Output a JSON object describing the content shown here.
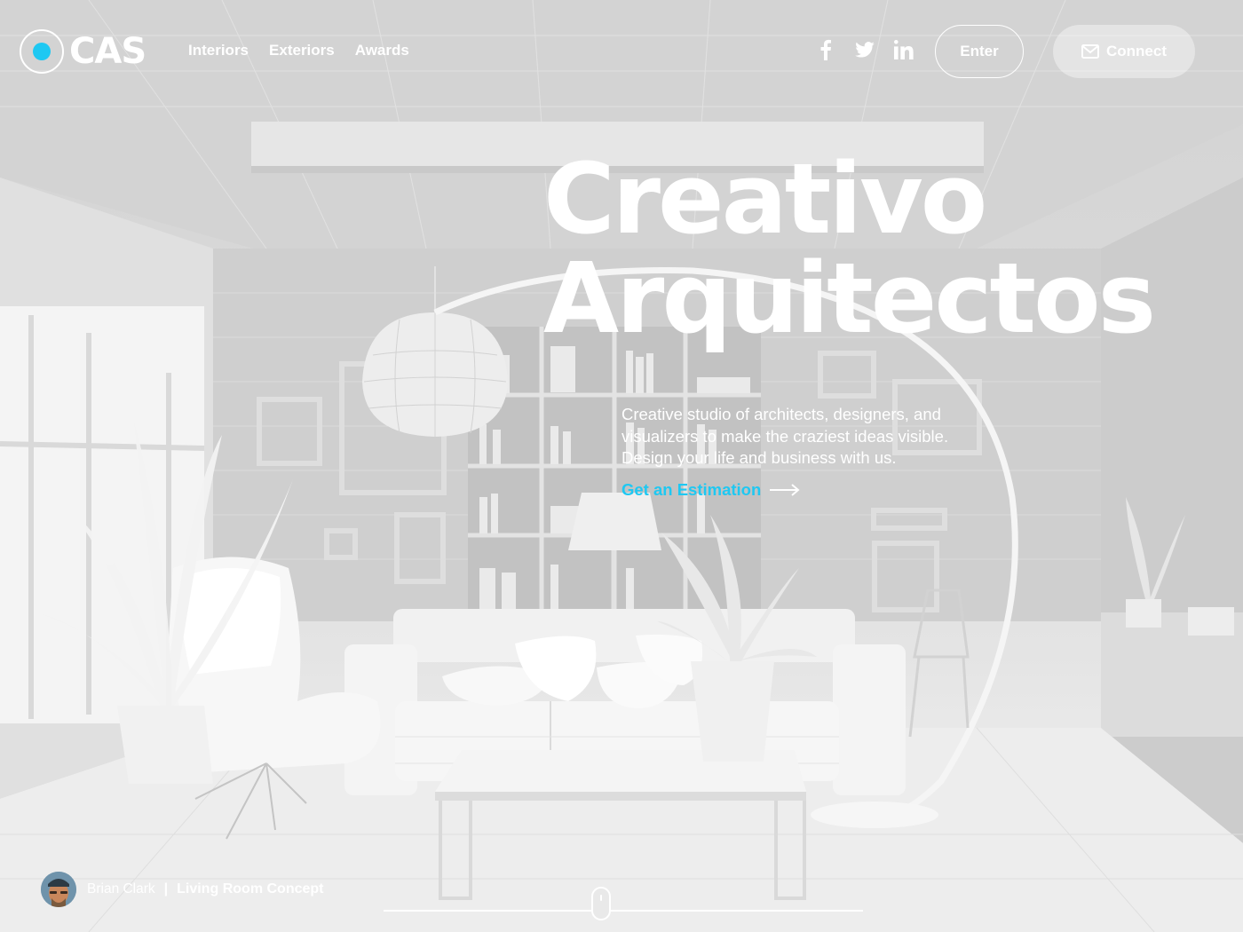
{
  "brand": {
    "logo_text": "CAS",
    "accent_color": "#1ec8f2"
  },
  "nav": {
    "items": [
      {
        "label": "Interiors"
      },
      {
        "label": "Exteriors"
      },
      {
        "label": "Awards"
      }
    ]
  },
  "social": {
    "icons": [
      "facebook-icon",
      "twitter-icon",
      "linkedin-icon"
    ]
  },
  "header": {
    "enter_label": "Enter",
    "connect_label": "Connect",
    "connect_icon": "mail-icon"
  },
  "hero": {
    "title_line1": "Creativo",
    "title_line2": "Arquitectos",
    "description_lines": [
      "Creative studio of architects, designers, and",
      "visualizers to make the craziest ideas visible.",
      "Design your life and business with us."
    ],
    "cta_label": "Get an Estimation",
    "cta_icon": "arrow-right-icon"
  },
  "credit": {
    "author": "Brian Clark",
    "separator": "|",
    "project": "Living Room Concept"
  },
  "scroll": {
    "icon": "mouse-scroll-icon"
  }
}
